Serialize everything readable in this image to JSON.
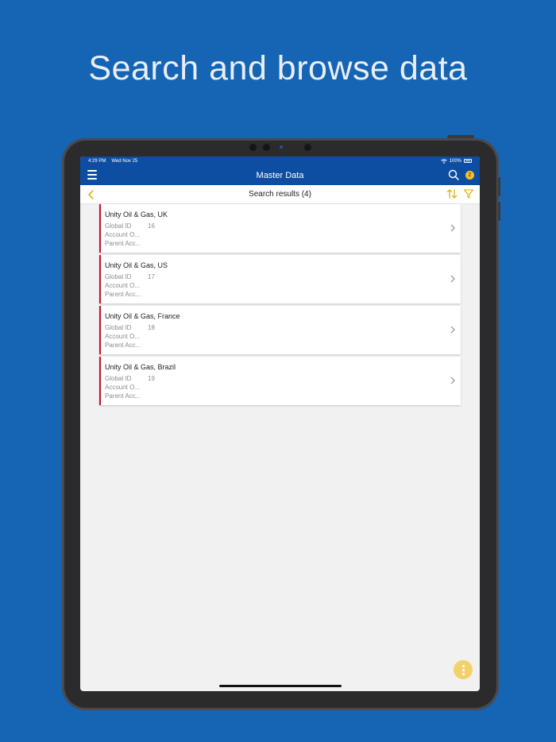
{
  "headline": "Search and browse data",
  "status_bar": {
    "time": "4:29 PM",
    "date": "Wed Nov 25",
    "battery": "100%"
  },
  "nav": {
    "title": "Master Data",
    "badge_count": "2"
  },
  "subbar": {
    "title": "Search results (4)"
  },
  "colors": {
    "primary": "#0d4ea3",
    "accent": "#f2c12e",
    "card_stripe": "#c8102e",
    "background": "#1565b4"
  },
  "icons": {
    "menu": "hamburger-icon",
    "search": "search-icon",
    "back": "chevron-left-icon",
    "sort": "sort-icon",
    "filter": "filter-icon",
    "more": "more-vertical-icon",
    "item": "chevron-right-icon"
  },
  "results": [
    {
      "name": "Unity Oil & Gas, UK",
      "global_id_label": "Global ID",
      "global_id": "16",
      "account_label": "Account O...",
      "parent_label": "Parent Acc..."
    },
    {
      "name": "Unity Oil & Gas, US",
      "global_id_label": "Global ID",
      "global_id": "17",
      "account_label": "Account O...",
      "parent_label": "Parent Acc..."
    },
    {
      "name": "Unity Oil & Gas, France",
      "global_id_label": "Global ID",
      "global_id": "18",
      "account_label": "Account O...",
      "parent_label": "Parent Acc..."
    },
    {
      "name": "Unity Oil & Gas, Brazil",
      "global_id_label": "Global ID",
      "global_id": "19",
      "account_label": "Account O...",
      "parent_label": "Parent Acc..."
    }
  ]
}
